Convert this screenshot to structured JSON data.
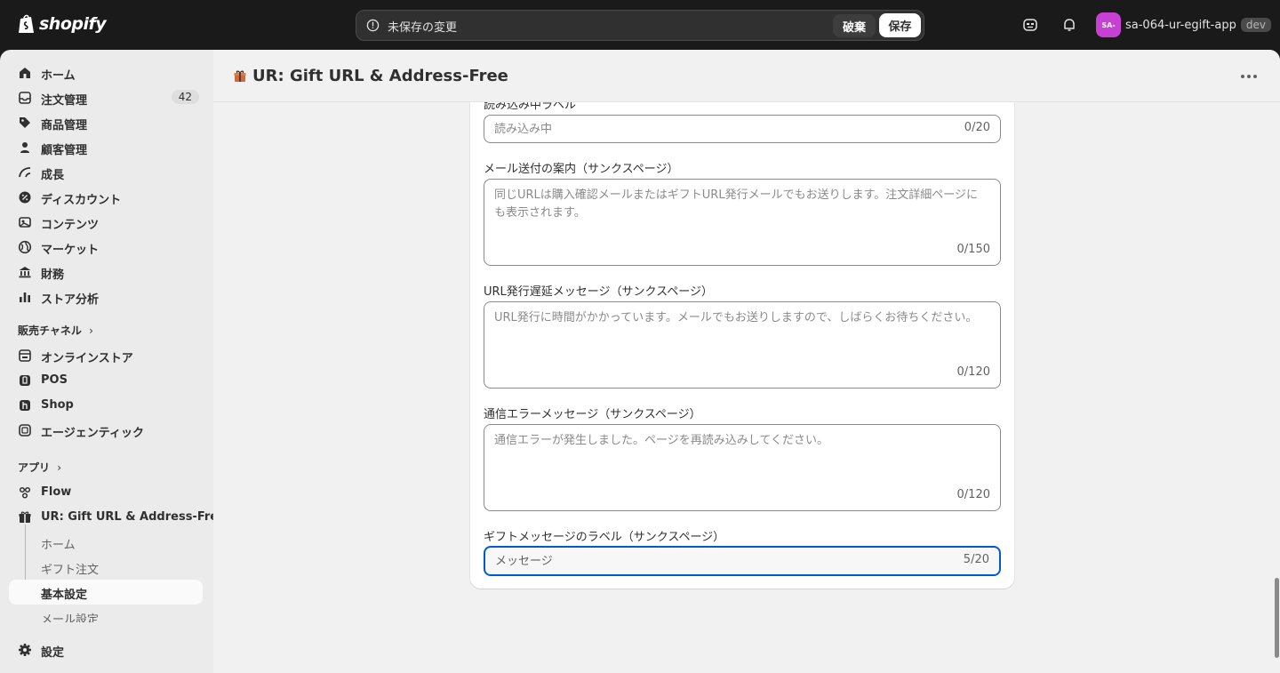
{
  "topbar": {
    "brand": "shopify",
    "unsaved_text": "未保存の変更",
    "discard_label": "破棄",
    "save_label": "保存",
    "avatar_initials": "SA-",
    "store_name": "sa-064-ur-egift-app",
    "env_badge": "dev"
  },
  "sidebar": {
    "items": [
      {
        "label": "ホーム",
        "icon": "home-icon"
      },
      {
        "label": "注文管理",
        "icon": "orders-icon",
        "badge": "42"
      },
      {
        "label": "商品管理",
        "icon": "tag-icon"
      },
      {
        "label": "顧客管理",
        "icon": "person-icon"
      },
      {
        "label": "成長",
        "icon": "growth-icon"
      },
      {
        "label": "ディスカウント",
        "icon": "discount-icon"
      },
      {
        "label": "コンテンツ",
        "icon": "content-icon"
      },
      {
        "label": "マーケット",
        "icon": "globe-icon"
      },
      {
        "label": "財務",
        "icon": "bank-icon"
      },
      {
        "label": "ストア分析",
        "icon": "chart-icon"
      }
    ],
    "sales_channels_label": "販売チャネル",
    "channels": [
      {
        "label": "オンラインストア",
        "icon": "store-icon"
      },
      {
        "label": "POS",
        "icon": "pos-icon"
      },
      {
        "label": "Shop",
        "icon": "shop-icon"
      },
      {
        "label": "エージェンティック",
        "icon": "agentic-icon"
      }
    ],
    "apps_label": "アプリ",
    "apps": [
      {
        "label": "Flow",
        "icon": "flow-icon"
      },
      {
        "label": "UR: Gift URL & Address-Free",
        "icon": "gift-icon"
      }
    ],
    "app_subitems": [
      "ホーム",
      "ギフト注文",
      "基本設定",
      "メール設定"
    ],
    "settings_label": "設定"
  },
  "header": {
    "title": "UR: Gift URL & Address-Free"
  },
  "form": {
    "loading_label": {
      "label": "読み込み中ラベル",
      "placeholder": "読み込み中",
      "count": "0/20"
    },
    "email_notice": {
      "label": "メール送付の案内（サンクスページ）",
      "placeholder": "同じURLは購入確認メールまたはギフトURL発行メールでもお送りします。注文詳細ページにも表示されます。",
      "count": "0/150"
    },
    "delay_message": {
      "label": "URL発行遅延メッセージ（サンクスページ）",
      "placeholder": "URL発行に時間がかかっています。メールでもお送りしますので、しばらくお待ちください。",
      "count": "0/120"
    },
    "error_message": {
      "label": "通信エラーメッセージ（サンクスページ）",
      "placeholder": "通信エラーが発生しました。ページを再読み込みしてください。",
      "count": "0/120"
    },
    "gift_message_label": {
      "label": "ギフトメッセージのラベル（サンクスページ）",
      "value": "メッセージ",
      "count": "5/20"
    }
  },
  "colors": {
    "topbar_bg": "#1a1a1a",
    "focus_ring": "#005bd3",
    "avatar": "#c740d4"
  }
}
